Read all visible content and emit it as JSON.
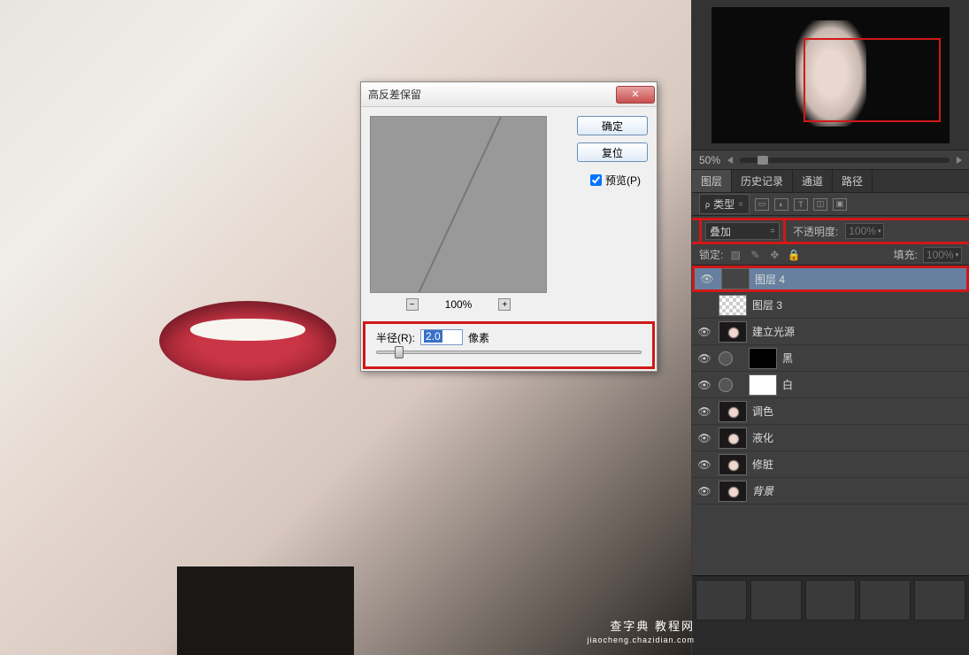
{
  "dialog": {
    "title": "高反差保留",
    "ok": "确定",
    "reset": "复位",
    "preview_label": "预览(P)",
    "zoom_percent": "100%",
    "radius_label": "半径(R):",
    "radius_value": "2.0",
    "radius_unit": "像素"
  },
  "navigator": {
    "zoom": "50%"
  },
  "panel_tabs": [
    "图层",
    "历史记录",
    "通道",
    "路径"
  ],
  "filter_row": {
    "type_label": "类型",
    "icons": [
      "▭",
      "◐",
      "T",
      "◫",
      "▣"
    ]
  },
  "blend_row": {
    "mode": "叠加",
    "opacity_label": "不透明度:",
    "opacity_value": "100%"
  },
  "lock_row": {
    "label": "锁定:",
    "fill_label": "填充:",
    "fill_value": "100%"
  },
  "layers": [
    {
      "name": "图层 4",
      "thumb": "gray",
      "selected": true,
      "visible": true
    },
    {
      "name": "图层 3",
      "thumb": "transparent",
      "visible": false
    },
    {
      "name": "建立光源",
      "thumb": "face",
      "visible": true
    },
    {
      "name": "黑",
      "thumb": "black",
      "visible": true,
      "fx": true
    },
    {
      "name": "白",
      "thumb": "white",
      "visible": true,
      "fx": true
    },
    {
      "name": "调色",
      "thumb": "face",
      "visible": true
    },
    {
      "name": "液化",
      "thumb": "face",
      "visible": true
    },
    {
      "name": "修脏",
      "thumb": "face",
      "visible": true
    },
    {
      "name": "背景",
      "thumb": "face",
      "visible": true,
      "italic": true
    }
  ],
  "watermark": {
    "line1": "查字典 教程网",
    "line2": "jiaocheng.chazidian.com"
  }
}
